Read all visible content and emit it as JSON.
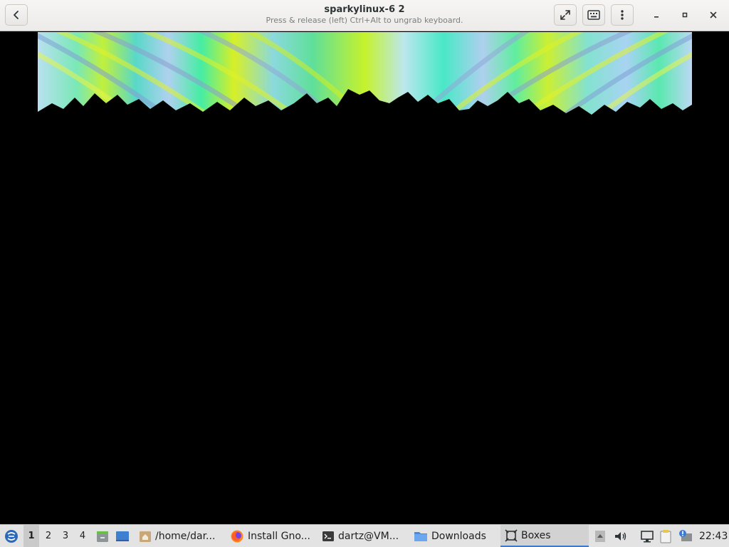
{
  "window": {
    "title": "sparkylinux-6 2",
    "subtitle": "Press & release (left) Ctrl+Alt to ungrab keyboard."
  },
  "header_icons": {
    "back": "back-arrow-icon",
    "fullscreen": "fullscreen-icon",
    "keyboard": "keyboard-icon",
    "menu": "kebab-menu-icon",
    "minimize": "minimize-icon",
    "maximize": "maximize-icon",
    "close": "close-icon"
  },
  "vm_display": {
    "banner_image": "fractal-wallpaper-image"
  },
  "taskbar": {
    "workspaces": [
      "1",
      "2",
      "3",
      "4"
    ],
    "active_workspace": "1",
    "tasks": [
      {
        "label": "/home/dar...",
        "icon": "folder-home-icon"
      },
      {
        "label": "Install Gno...",
        "icon": "firefox-icon"
      },
      {
        "label": "dartz@VM...",
        "icon": "terminal-icon"
      },
      {
        "label": "Downloads",
        "icon": "folder-icon"
      },
      {
        "label": "Boxes",
        "icon": "boxes-icon",
        "active": true
      }
    ],
    "clock": "22:43"
  },
  "colors": {
    "headerbar": "#f6f5f4",
    "taskbar": "#e3e3e3",
    "active_task_underline": "#3e7ac8",
    "screen": "#000000"
  }
}
